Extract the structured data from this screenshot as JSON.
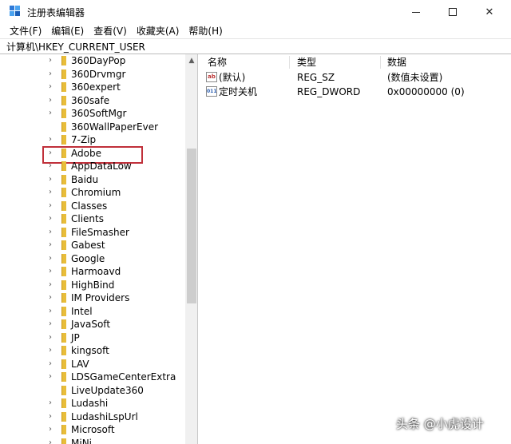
{
  "window": {
    "title": "注册表编辑器",
    "accent": "#c0303a"
  },
  "menu": [
    {
      "label": "文件(F)"
    },
    {
      "label": "编辑(E)"
    },
    {
      "label": "查看(V)"
    },
    {
      "label": "收藏夹(A)"
    },
    {
      "label": "帮助(H)"
    }
  ],
  "address": {
    "path": "计算机\\HKEY_CURRENT_USER"
  },
  "tree": {
    "items": [
      {
        "label": "360DayPop",
        "expandable": true
      },
      {
        "label": "360Drvmgr",
        "expandable": true
      },
      {
        "label": "360expert",
        "expandable": true
      },
      {
        "label": "360safe",
        "expandable": true
      },
      {
        "label": "360SoftMgr",
        "expandable": true
      },
      {
        "label": "360WallPaperEver",
        "expandable": false
      },
      {
        "label": "7-Zip",
        "expandable": true
      },
      {
        "label": "Adobe",
        "expandable": true,
        "highlighted": true
      },
      {
        "label": "AppDataLow",
        "expandable": true
      },
      {
        "label": "Baidu",
        "expandable": true
      },
      {
        "label": "Chromium",
        "expandable": true
      },
      {
        "label": "Classes",
        "expandable": true
      },
      {
        "label": "Clients",
        "expandable": true
      },
      {
        "label": "FileSmasher",
        "expandable": true
      },
      {
        "label": "Gabest",
        "expandable": true
      },
      {
        "label": "Google",
        "expandable": true
      },
      {
        "label": "Harmoavd",
        "expandable": true
      },
      {
        "label": "HighBind",
        "expandable": true
      },
      {
        "label": "IM Providers",
        "expandable": true
      },
      {
        "label": "Intel",
        "expandable": true
      },
      {
        "label": "JavaSoft",
        "expandable": true
      },
      {
        "label": "JP",
        "expandable": true
      },
      {
        "label": "kingsoft",
        "expandable": true
      },
      {
        "label": "LAV",
        "expandable": true
      },
      {
        "label": "LDSGameCenterExtra",
        "expandable": true
      },
      {
        "label": "LiveUpdate360",
        "expandable": false
      },
      {
        "label": "Ludashi",
        "expandable": true
      },
      {
        "label": "LudashiLspUrl",
        "expandable": true
      },
      {
        "label": "Microsoft",
        "expandable": true
      },
      {
        "label": "MiNi",
        "expandable": true
      }
    ]
  },
  "values": {
    "headers": {
      "name": "名称",
      "type": "类型",
      "data": "数据"
    },
    "rows": [
      {
        "icon": "string-value-icon",
        "name": "(默认)",
        "type": "REG_SZ",
        "data": "(数值未设置)"
      },
      {
        "icon": "binary-value-icon",
        "name": "定时关机",
        "type": "REG_DWORD",
        "data": "0x00000000 (0)"
      }
    ]
  },
  "watermark": {
    "text": "头条 @小虎设计"
  }
}
